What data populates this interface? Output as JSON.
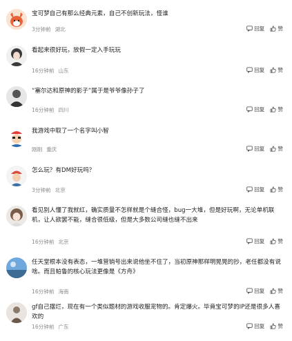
{
  "actions": {
    "reply_label": "回复",
    "like_label": "赞"
  },
  "comments": [
    {
      "text": "宝可梦自己有那么经典元素，自己不创新玩法，怪谁",
      "time": "3分钟前",
      "location": "湖北",
      "avatar_icon": "fox-avatar-icon",
      "avatar_color": "#e8633a"
    },
    {
      "text": "看起来很好玩，放假一定入手玩玩",
      "time": "16分钟前",
      "location": "山东",
      "avatar_icon": "girl-avatar-icon",
      "avatar_color": "#3a3a3a"
    },
    {
      "text": "“塞尔达和原神的影子”属于是爷爷像孙子了",
      "time": "16分钟前",
      "location": "四川",
      "avatar_icon": "dark-figure-avatar-icon",
      "avatar_color": "#555555"
    },
    {
      "text": "我游戏中取了一个名字叫小智",
      "time": "刚刚",
      "location": "重庆",
      "avatar_icon": "cartoon-boy-avatar-icon",
      "avatar_color": "#2b6cb0"
    },
    {
      "text": "怎么玩？有DM好玩吗？",
      "time": "3分钟前",
      "location": "北京",
      "avatar_icon": "trainer-avatar-icon",
      "avatar_color": "#d94c3d"
    },
    {
      "text": "看见别人懂了我就红，确实质量不怎样就是个缝合怪，bug一大堆，但是好玩啊，无论单机联机，让人欲罢不能，缝合很低级，但是大多数公司缝也缝不出来",
      "time": "16分钟前",
      "location": "北京",
      "avatar_icon": "anime-girl-avatar-icon",
      "avatar_color": "#7a5c4a"
    },
    {
      "text": "任天堂根本没有表态，一堆营销号出来说他坐不住了，当初原神那样明晃晃的抄，老任都没有说啥。而且帕鲁的核心玩法更像是《方舟》",
      "time": "16分钟前",
      "location": "海南",
      "avatar_icon": "scenery-avatar-icon",
      "avatar_color": "#6fa8dc"
    },
    {
      "text": "gf自己摆烂，现在有一个类似题材的游戏收服宠物的。肯定爆火。毕竟宝可梦的IP还是很多人喜欢的",
      "time": "16分钟前",
      "location": "广东",
      "avatar_icon": "figure-avatar-icon",
      "avatar_color": "#8c7b6b"
    }
  ]
}
